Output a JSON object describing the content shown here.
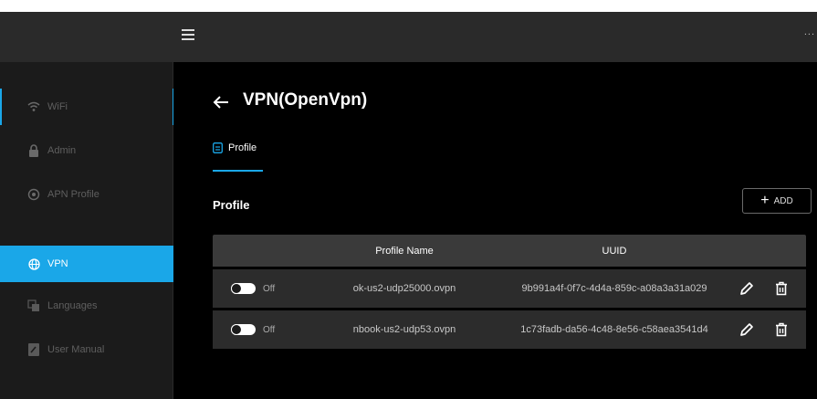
{
  "sidebar": {
    "items": [
      {
        "label": "WiFi",
        "icon": "wifi-icon",
        "state": "focused"
      },
      {
        "label": "Admin",
        "icon": "lock-icon",
        "state": "normal"
      },
      {
        "label": "APN Profile",
        "icon": "apn-profile-icon",
        "state": "normal"
      },
      {
        "label": "VPN",
        "icon": "globe-icon",
        "state": "active"
      },
      {
        "label": "Languages",
        "icon": "language-icon",
        "state": "normal"
      },
      {
        "label": "User Manual",
        "icon": "manual-icon",
        "state": "normal"
      }
    ]
  },
  "topbar": {
    "menu_icon": "hamburger-menu-icon",
    "more_label": "..."
  },
  "main": {
    "title": "VPN(OpenVpn)",
    "tab_label": "Profile",
    "section_title": "Profile",
    "add_label": "ADD"
  },
  "table": {
    "headers": {
      "name": "Profile Name",
      "uuid": "UUID"
    },
    "rows": [
      {
        "enabled": false,
        "status": "Off",
        "name": "ok-us2-udp25000.ovpn",
        "uuid": "9b991a4f-0f7c-4d4a-859c-a08a3a31a029"
      },
      {
        "enabled": false,
        "status": "Off",
        "name": "nbook-us2-udp53.ovpn",
        "uuid": "1c73fadb-da56-4c48-8e56-c58aea3541d4"
      }
    ]
  },
  "colors": {
    "accent": "#1aa7e8",
    "background": "#000000",
    "sidebar": "#1b1b1b",
    "topbar": "#2a2a2a",
    "table_header": "#3a3a3a",
    "table_row": "#2c2c2c"
  }
}
